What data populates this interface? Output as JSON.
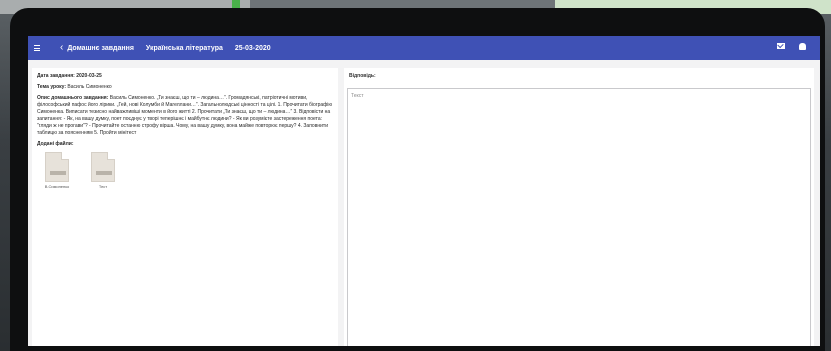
{
  "header": {
    "back_label": "Домашнє завдання",
    "subject": "Українська література",
    "date": "25-03-2020"
  },
  "assignment": {
    "date_label": "Дата завдання:",
    "date_value": "2020-03-25",
    "topic_label": "Тема уроку:",
    "topic_value": "Василь Симоненко",
    "desc_label": "Опис домашнього завдання:",
    "desc_value": "Василь Симоненко. „Ти знаєш, що ти – людина…”. Громадянські, патріотичні мотиви, філософський пафос його лірики. „Гей, нові Колумби й Магеллани…”. Загальнолюдські цінності та цілі. 1. Прочитати біографію Симоненка. Виписати тезисно найважливіші моменти в його житті 2. Прочитати „Ти знаєш, що ти – людина…” 3. Відповісти на запитання: - Як, на вашу думку, поет поєднує у творі теперішнє і майбутнє людини? - Як ви розумієте застереження поета: \"гляди ж не прогави\"? - Прочитайте останню строфу вірша. Чому, на вашу думку, вона майже повторює першу? 4. Заповнити таблицю за поясненням 5. Пройти мінітест",
    "files_label": "Додані файли:",
    "files": [
      {
        "name": "В.Симоненко"
      },
      {
        "name": "Тест"
      }
    ]
  },
  "answer": {
    "label": "Відповідь:",
    "placeholder": "Текст"
  },
  "icons": {
    "menu": "menu-icon",
    "back": "chevron-left-icon",
    "mail": "mail-icon",
    "notifications": "bell-icon",
    "file": "file-icon"
  },
  "colors": {
    "header": "#3f51b5",
    "panel": "#ffffff",
    "screen_bg": "#f3f3f4"
  }
}
